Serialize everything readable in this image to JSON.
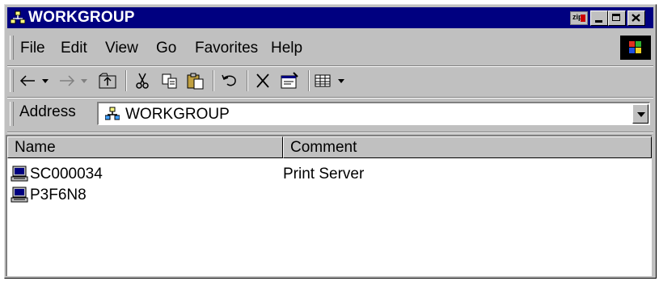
{
  "window": {
    "title": "WORKGROUP"
  },
  "menu": {
    "items": [
      "File",
      "Edit",
      "View",
      "Go",
      "Favorites",
      "Help"
    ]
  },
  "toolbar": {
    "icons": [
      "back-icon",
      "forward-icon",
      "up-folder-icon",
      "cut-icon",
      "copy-icon",
      "paste-icon",
      "undo-icon",
      "delete-icon",
      "properties-icon",
      "views-icon"
    ]
  },
  "address": {
    "label": "Address",
    "value": "WORKGROUP"
  },
  "list": {
    "columns": [
      "Name",
      "Comment"
    ],
    "rows": [
      {
        "name": "SC000034",
        "comment": "Print Server"
      },
      {
        "name": "P3F6N8",
        "comment": ""
      }
    ]
  }
}
